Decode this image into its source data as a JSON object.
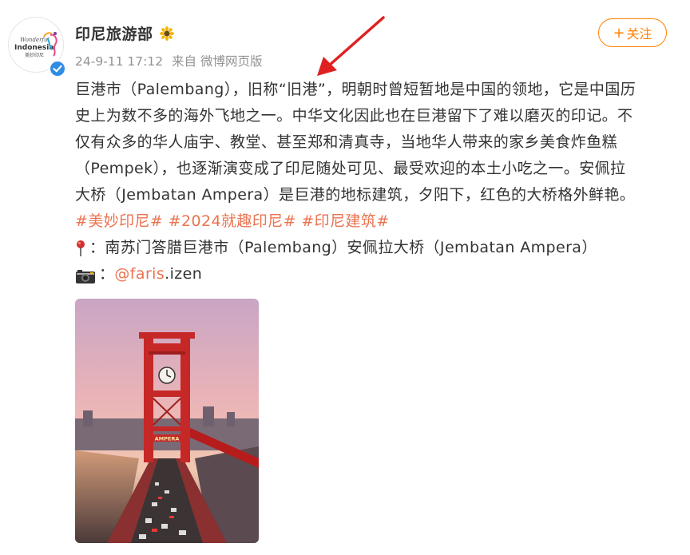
{
  "account": {
    "name": "印尼旅游部",
    "avatar_text_top": "Wonderful",
    "avatar_text_main": "Indonesia",
    "avatar_text_cn": "美妙印尼"
  },
  "meta": {
    "timestamp": "24-9-11 17:12",
    "source": "来自 微博网页版"
  },
  "follow": {
    "plus": "+",
    "label": "关注"
  },
  "post": {
    "line1": "巨港市（Palembang），旧称“旧港”，明朝时曾短暂地是中国的领地，它是中国历",
    "line2": "史上为数不多的海外飞地之一。中华文化因此也在巨港留下了难以磨灭的印记。不",
    "line3": "仅有众多的华人庙宇、教堂、甚至郑和清真寺，当地华人带来的家乡美食炸鱼糕",
    "line4": "（Pempek），也逐渐演变成了印尼随处可见、最受欢迎的本土小吃之一。安佩拉",
    "line5": "大桥（Jembatan Ampera）是巨港的地标建筑，夕阳下，红色的大桥格外鲜艳。",
    "tags": [
      "#美妙印尼#",
      "#2024就趣印尼#",
      "#印尼建筑#"
    ],
    "location_prefix": "：",
    "location": "南苏门答腊巨港市（Palembang）安佩拉大桥（Jembatan Ampera）",
    "photo_prefix": "：",
    "mention": "@faris",
    "mention_suffix": ".izen"
  },
  "photo": {
    "sign_text": "AMPERA"
  },
  "colors": {
    "accent": "#ff8200",
    "link": "#eb7350",
    "meta": "#939393",
    "arrow": "#e02020",
    "bridge": "#c62828"
  },
  "icons": {
    "verified": "verified-badge-icon",
    "sunflower": "sunflower-icon",
    "pin": "map-pin-icon",
    "camera": "camera-icon"
  }
}
